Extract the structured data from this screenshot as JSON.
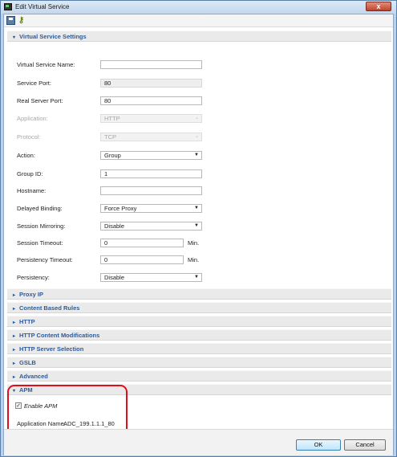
{
  "window": {
    "title": "Edit Virtual Service",
    "close_label": "x"
  },
  "sections": {
    "virtual_service_settings": "Virtual Service Settings",
    "proxy_ip": "Proxy IP",
    "content_based_rules": "Content Based Rules",
    "http": "HTTP",
    "http_content_modifications": "HTTP Content Modifications",
    "http_server_selection": "HTTP Server Selection",
    "gslb": "GSLB",
    "advanced": "Advanced",
    "apm": "APM"
  },
  "form": {
    "virtual_service_name": {
      "label": "Virtual Service Name:",
      "value": ""
    },
    "service_port": {
      "label": "Service Port:",
      "value": "80"
    },
    "real_server_port": {
      "label": "Real Server Port:",
      "value": "80"
    },
    "application": {
      "label": "Application:",
      "value": "HTTP"
    },
    "protocol": {
      "label": "Protocol:",
      "value": "TCP"
    },
    "action": {
      "label": "Action:",
      "value": "Group"
    },
    "group_id": {
      "label": "Group ID:",
      "value": "1"
    },
    "hostname": {
      "label": "Hostname:",
      "value": ""
    },
    "delayed_binding": {
      "label": "Delayed Binding:",
      "value": "Force Proxy"
    },
    "session_mirroring": {
      "label": "Session Mirroring:",
      "value": "Disable"
    },
    "session_timeout": {
      "label": "Session Timeout:",
      "value": "0",
      "unit": "Min."
    },
    "persistency_timeout": {
      "label": "Persistency Timeout:",
      "value": "0",
      "unit": "Min."
    },
    "persistency": {
      "label": "Persistency:",
      "value": "Disable"
    }
  },
  "apm": {
    "enable_label": "Enable APM",
    "enabled": true,
    "application_name_label": "Application Name:",
    "application_name_value": "ADC_199.1.1.1_80"
  },
  "buttons": {
    "ok": "OK",
    "cancel": "Cancel"
  },
  "icons": {
    "expanded_arrow": "▾",
    "collapsed_arrow": "▸",
    "select_caret": "▼",
    "check": "✓"
  },
  "colors": {
    "section_text": "#2d5b9b",
    "highlight": "#e0101a"
  }
}
